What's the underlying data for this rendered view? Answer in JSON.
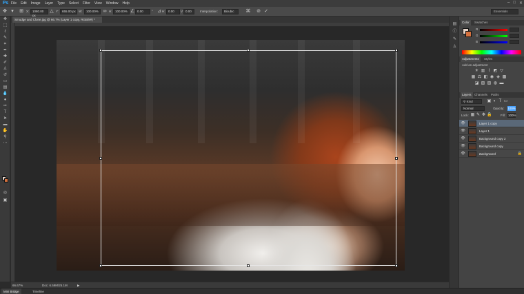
{
  "app": {
    "logo": "Ps"
  },
  "menu": [
    "File",
    "Edit",
    "Image",
    "Layer",
    "Type",
    "Select",
    "Filter",
    "View",
    "Window",
    "Help"
  ],
  "window_controls": {
    "minimize": "–",
    "maximize": "□",
    "close": "✕"
  },
  "options_bar": {
    "x_value": "1080.00 px",
    "y_value": "655.00 px",
    "w_value": "100.00%",
    "h_value": "100.00%",
    "angle_value": "0.00",
    "h_skew_value": "0.00",
    "v_skew_value": "0.00",
    "interpolation_label": "Interpolation:",
    "interpolation_value": "Bicubic",
    "workspace": "Essentials"
  },
  "document": {
    "tab_title": "Smudge and Clone.jpg @ 66.7% (Layer 1 copy, RGB/8#) *",
    "zoom": "66.67%",
    "doc_info": "Doc: 6.59M/25.1M"
  },
  "bottom_tabs": [
    "Mini Bridge",
    "Timeline"
  ],
  "panels": {
    "color_tabs": [
      "Color",
      "Swatches"
    ],
    "color_channels": [
      {
        "label": "R",
        "value": ""
      },
      {
        "label": "G",
        "value": ""
      },
      {
        "label": "B",
        "value": ""
      }
    ],
    "adjustments_tabs": [
      "Adjustments",
      "Styles"
    ],
    "adjustments_hint": "Add an adjustment",
    "layers_tabs": [
      "Layers",
      "Channels",
      "Paths"
    ],
    "layers_filter": "Kind",
    "blend_mode": "Normal",
    "opacity_label": "Opacity:",
    "opacity_value": "100%",
    "lock_label": "Lock:",
    "fill_label": "Fill:",
    "fill_value": "100%",
    "layers": [
      {
        "name": "Layer 1 copy",
        "selected": true
      },
      {
        "name": "Layer 1",
        "selected": false
      },
      {
        "name": "Background copy 2",
        "selected": false
      },
      {
        "name": "Background copy",
        "selected": false
      },
      {
        "name": "Background",
        "selected": false,
        "locked": true
      }
    ]
  },
  "colors": {
    "foreground": "#e6d4c8",
    "background": "#d5713e",
    "selected_layer": "#5a6878",
    "ps_blue": "#31a8ff"
  }
}
